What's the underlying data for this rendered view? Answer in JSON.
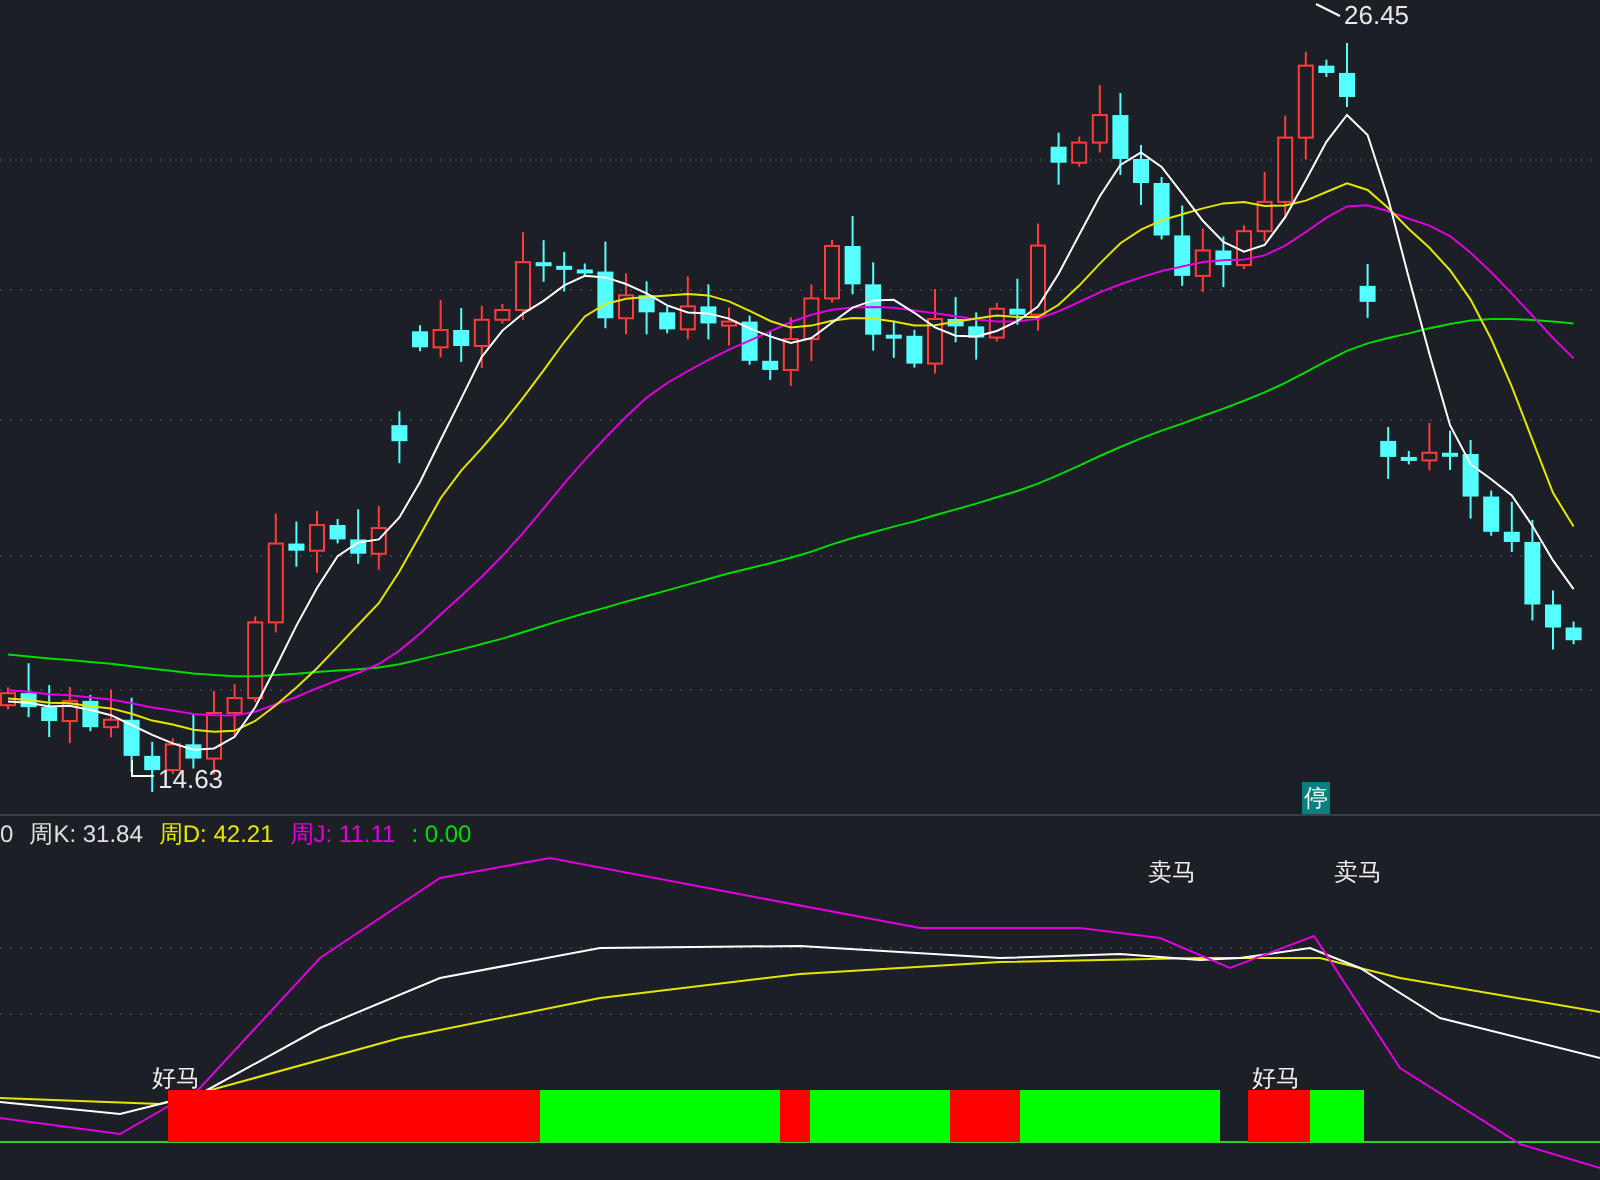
{
  "price_chart": {
    "high_label": "26.45",
    "low_label": "14.63",
    "halt_badge": "停"
  },
  "indicator": {
    "title_prefix": "0",
    "readouts": [
      {
        "label": "周K: 31.84",
        "color": "#e0e0e0"
      },
      {
        "label": "周D: 42.21",
        "color": "#e6e600"
      },
      {
        "label": "周J: 11.11",
        "color": "#e000e0"
      },
      {
        "label": ": 0.00",
        "color": "#00e000"
      }
    ],
    "signals": [
      {
        "text": "卖马"
      },
      {
        "text": "卖马"
      },
      {
        "text": "好马"
      },
      {
        "text": "好马"
      }
    ]
  }
}
